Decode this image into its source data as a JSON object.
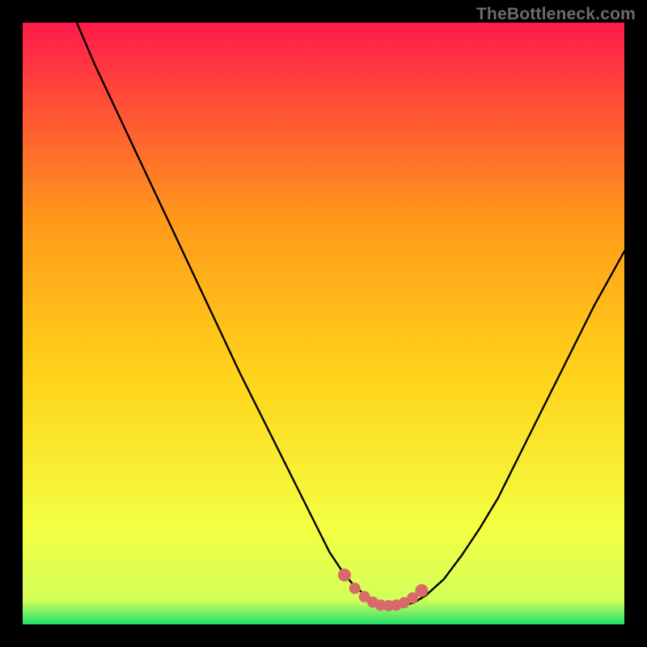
{
  "attribution": "TheBottleneck.com",
  "colors": {
    "bg_black": "#000000",
    "curve": "#000000",
    "marker_fill": "#d86a6a",
    "marker_stroke": "#d86a6a",
    "gradient_top": "#ff1a4b",
    "gradient_mid_upper": "#ff7a2a",
    "gradient_mid": "#ffd21a",
    "gradient_mid_lower": "#f7ff3a",
    "gradient_bottom": "#22e06a"
  },
  "chart_data": {
    "type": "line",
    "title": "",
    "xlabel": "",
    "ylabel": "",
    "xlim": [
      0,
      100
    ],
    "ylim": [
      0,
      100
    ],
    "curve": {
      "x": [
        9,
        12,
        16,
        20,
        24,
        28,
        32,
        36,
        40,
        44,
        48,
        51,
        53,
        55,
        57,
        59,
        61,
        63,
        65,
        67,
        70,
        73,
        76,
        79,
        82,
        86,
        90,
        95,
        100
      ],
      "y": [
        100,
        93,
        84.5,
        76,
        67.5,
        59,
        50.5,
        42,
        34,
        26,
        18,
        12,
        9,
        6.5,
        4.8,
        3.6,
        3.1,
        3.1,
        3.6,
        4.8,
        7.5,
        11.5,
        16,
        21,
        27,
        35,
        43,
        53,
        62
      ]
    },
    "markers": {
      "x": [
        53.5,
        55.2,
        56.8,
        58.2,
        59.5,
        60.8,
        62.1,
        63.4,
        64.8,
        66.3
      ],
      "y": [
        8.2,
        6.0,
        4.6,
        3.7,
        3.2,
        3.1,
        3.2,
        3.6,
        4.4,
        5.6
      ]
    }
  }
}
